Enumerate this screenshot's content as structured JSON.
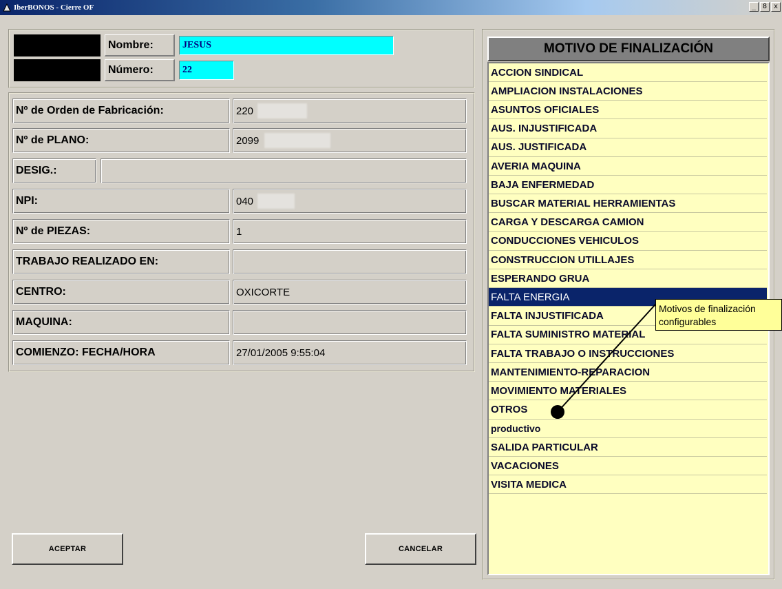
{
  "window": {
    "title": "IberBONOS - Cierre OF",
    "minimize": "_",
    "maximize": "8",
    "close": "x"
  },
  "header": {
    "nombre_label": "Nombre:",
    "nombre_value": "JESUS",
    "numero_label": "Número:",
    "numero_value": "22"
  },
  "fields": {
    "orden_label": "Nº de Orden de Fabricación:",
    "orden_value": "220",
    "plano_label": "Nº de PLANO:",
    "plano_value": "2099",
    "desig_label": "DESIG.:",
    "desig_value": "",
    "npi_label": "NPI:",
    "npi_value": "040",
    "piezas_label": "Nº de PIEZAS:",
    "piezas_value": "1",
    "trabajo_label": "TRABAJO REALIZADO EN:",
    "trabajo_value": "",
    "centro_label": "CENTRO:",
    "centro_value": "OXICORTE",
    "maquina_label": "MAQUINA:",
    "maquina_value": "",
    "comienzo_label": "COMIENZO: FECHA/HORA",
    "comienzo_value": "27/01/2005 9:55:04"
  },
  "buttons": {
    "aceptar": "ACEPTAR",
    "cancelar": "CANCELAR"
  },
  "reasons": {
    "header": "MOTIVO DE FINALIZACIÓN",
    "selected_index": 12,
    "items": [
      "ACCION SINDICAL",
      "AMPLIACION INSTALACIONES",
      "ASUNTOS OFICIALES",
      "AUS. INJUSTIFICADA",
      "AUS. JUSTIFICADA",
      "AVERIA MAQUINA",
      "BAJA ENFERMEDAD",
      "BUSCAR MATERIAL HERRAMIENTAS",
      "CARGA Y DESCARGA CAMION",
      "CONDUCCIONES VEHICULOS",
      "CONSTRUCCION UTILLAJES",
      "ESPERANDO GRUA",
      "FALTA ENERGIA",
      "FALTA INJUSTIFICADA",
      "FALTA SUMINISTRO MATERIAL",
      "FALTA TRABAJO O INSTRUCCIONES",
      "MANTENIMIENTO-REPARACION",
      "MOVIMIENTO MATERIALES",
      "OTROS",
      "productivo",
      "SALIDA PARTICULAR",
      "VACACIONES",
      "VISITA MEDICA"
    ]
  },
  "callout": {
    "line1": "Motivos de finalización",
    "line2": "configurables"
  },
  "colors": {
    "list_background": "#ffffc0",
    "selection": "#0a246a",
    "cyan_field": "#00ffff",
    "callout_background": "#ffff99"
  }
}
